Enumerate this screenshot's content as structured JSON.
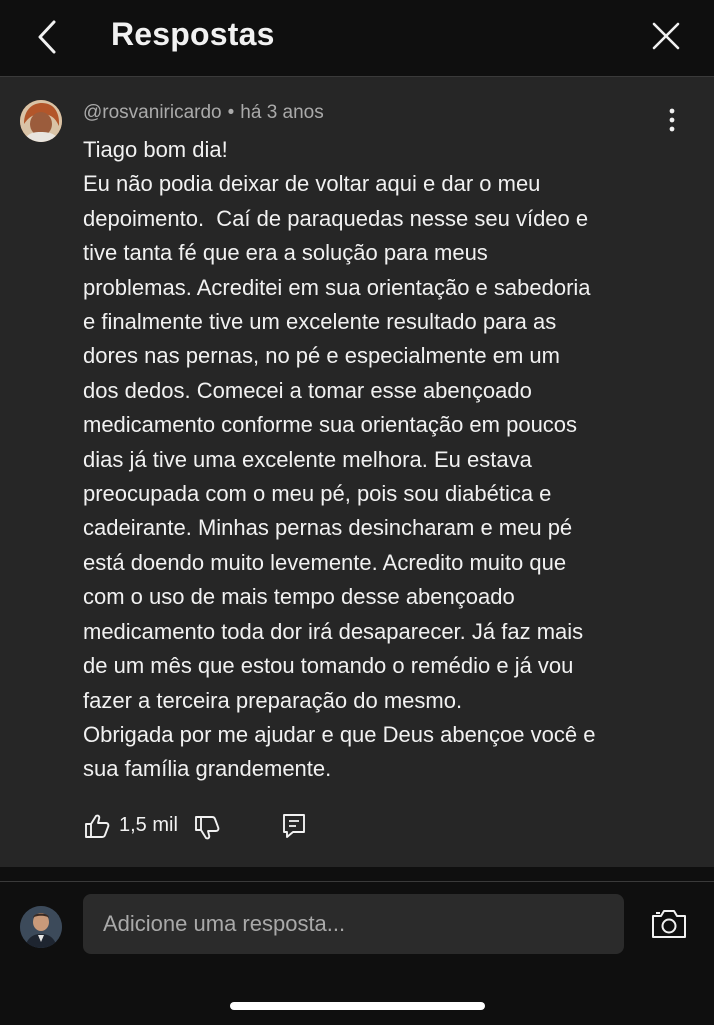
{
  "header": {
    "title": "Respostas",
    "back_icon": "chevron-left-icon",
    "close_icon": "close-icon"
  },
  "comment": {
    "author": "@rosvaniricardo",
    "separator": "•",
    "time": "há 3 anos",
    "lines": [
      "Tiago bom dia!",
      "Eu não podia deixar de voltar aqui e dar o meu",
      "depoimento.  Caí de paraquedas nesse seu vídeo e",
      "tive tanta fé que era a solução para meus",
      "problemas. Acreditei em sua orientação e sabedoria",
      "e finalmente tive um excelente resultado para as",
      "dores nas pernas, no pé e especialmente em um",
      "dos dedos. Comecei a tomar esse abençoado",
      "medicamento conforme sua orientação em poucos",
      "dias já tive uma excelente melhora. Eu estava",
      "preocupada com o meu pé, pois sou diabética e",
      "cadeirante. Minhas pernas desincharam e meu pé",
      "está doendo muito levemente. Acredito muito que",
      "com o uso de mais tempo desse abençoado",
      "medicamento toda dor irá desaparecer. Já faz mais",
      "de um mês que estou tomando o remédio e já vou",
      "fazer a terceira preparação do mesmo.",
      "Obrigada por me ajudar e que Deus abençoe você e",
      "sua família grandemente."
    ],
    "like_count": "1,5 mil",
    "icons": {
      "more": "more-vertical-icon",
      "like": "thumbs-up-icon",
      "dislike": "thumbs-down-icon",
      "reply": "reply-comment-icon"
    }
  },
  "reply_bar": {
    "placeholder": "Adicione uma resposta...",
    "camera_icon": "camera-icon"
  },
  "colors": {
    "background": "#0f0f0f",
    "panel": "#262626",
    "input": "#2b2b2b",
    "text": "#f1f1f1",
    "muted": "#aaaaaa"
  }
}
